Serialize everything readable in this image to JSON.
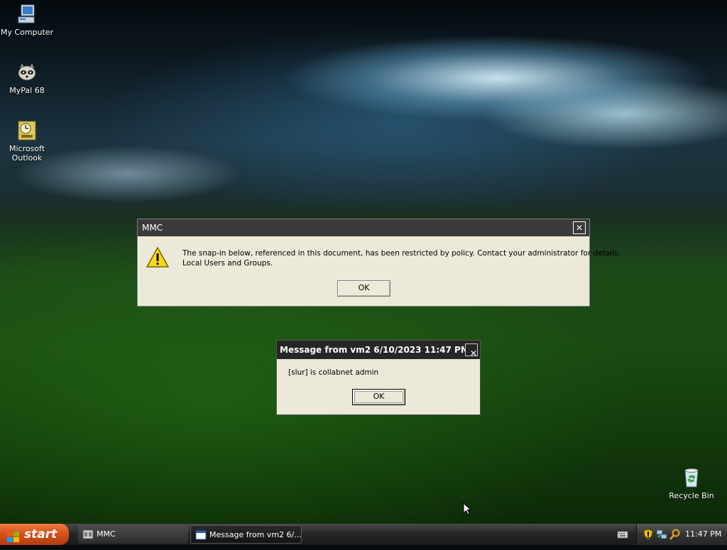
{
  "desktop": {
    "icons": [
      {
        "label": "My Computer"
      },
      {
        "label": "MyPal 68"
      },
      {
        "label": "Microsoft\nOutlook"
      },
      {
        "label": "Recycle Bin"
      }
    ]
  },
  "mmc_dialog": {
    "title": "MMC",
    "message_line1": "The snap-in below, referenced in this document, has been restricted by policy. Contact your administrator for details.",
    "message_line2": "Local Users and Groups.",
    "ok_label": "OK",
    "icon": "warning-icon"
  },
  "message_dialog": {
    "title": "Message from vm2 6/10/2023 11:47 PM",
    "message": "[slur] is collabnet admin",
    "ok_label": "OK"
  },
  "taskbar": {
    "start_label": "start",
    "tasks": [
      {
        "label": "MMC",
        "icon": "mmc-icon"
      },
      {
        "label": "Message from vm2 6/...",
        "icon": "window-icon"
      }
    ],
    "clock": "11:47 PM",
    "tray_icons": [
      "keyboard-icon",
      "security-shield-icon",
      "network-icon",
      "search-icon"
    ]
  },
  "colors": {
    "title_active": "#3a3a3a",
    "taskbar": "#262626",
    "start_button": "#d3501a"
  }
}
